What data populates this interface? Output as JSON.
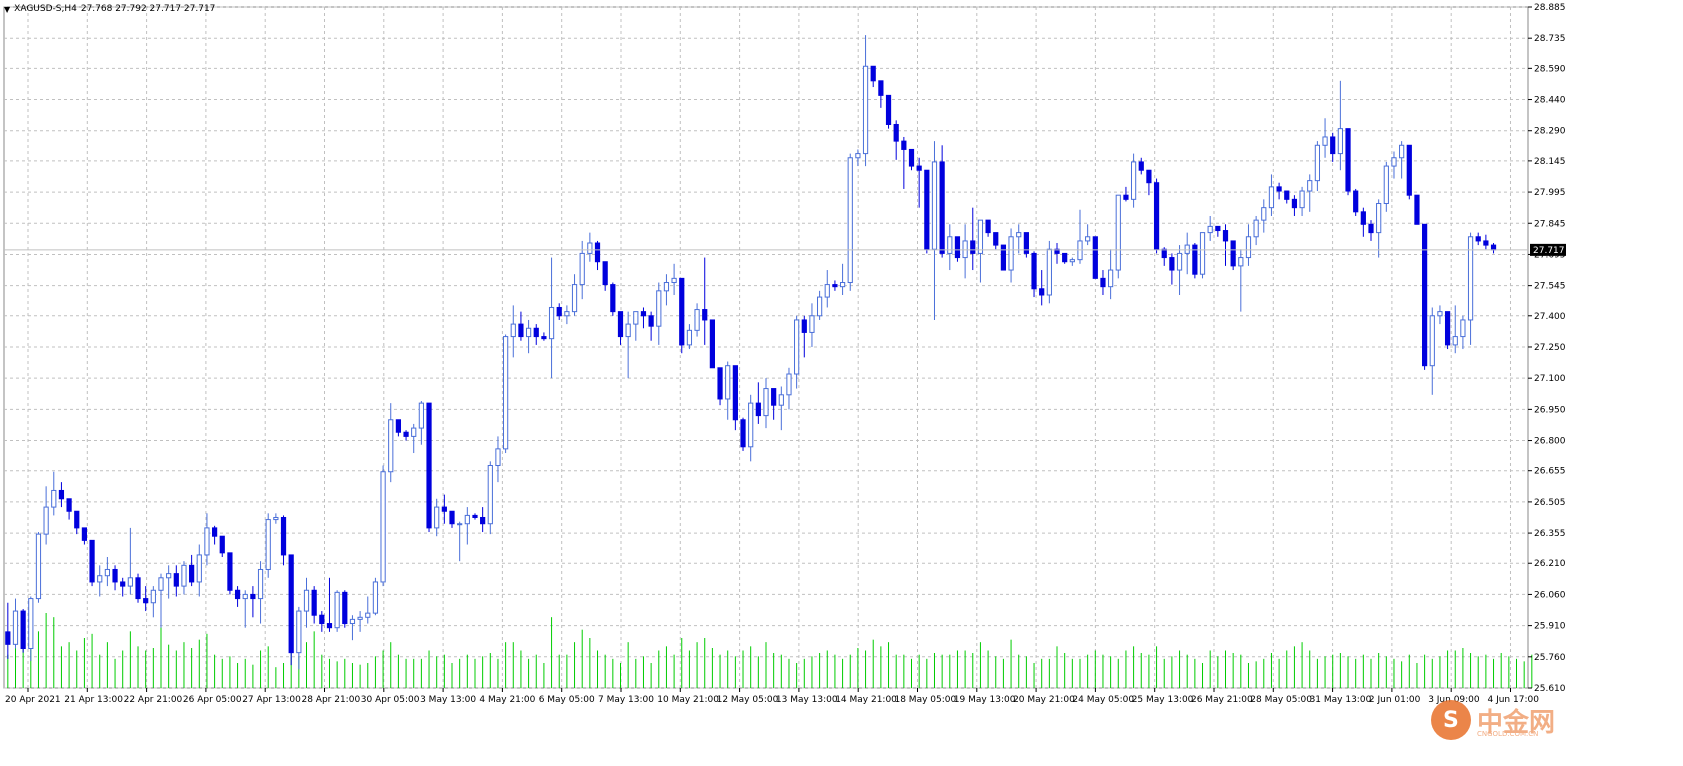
{
  "header": {
    "symbol": "XAGUSD-S,H4",
    "ohlc": "27.768 27.792 27.717 27.717"
  },
  "watermark": {
    "glyph": "S",
    "name": "中金网",
    "site": "CNGOLD.COM.CN"
  },
  "colors": {
    "bear": "#0000dd",
    "bull": "#4a6fd9",
    "volume": "#00cc00",
    "grid": "#c0c0c0",
    "last_price_line": "#c0c0c0",
    "price_label_bg": "#000000"
  },
  "chart_data": {
    "type": "candlestick",
    "y_ticks": [
      "28.885",
      "28.735",
      "28.590",
      "28.440",
      "28.290",
      "28.145",
      "27.995",
      "27.845",
      "27.695",
      "27.545",
      "27.400",
      "27.250",
      "27.100",
      "26.950",
      "26.800",
      "26.655",
      "26.505",
      "26.355",
      "26.210",
      "26.060",
      "25.910",
      "25.760",
      "25.610"
    ],
    "ylim": [
      25.61,
      28.885
    ],
    "x_ticks": [
      "20 Apr 2021",
      "21 Apr 13:00",
      "22 Apr 21:00",
      "26 Apr 05:00",
      "27 Apr 13:00",
      "28 Apr 21:00",
      "30 Apr 05:00",
      "3 May 13:00",
      "4 May 21:00",
      "6 May 05:00",
      "7 May 13:00",
      "10 May 21:00",
      "12 May 05:00",
      "13 May 13:00",
      "14 May 21:00",
      "18 May 05:00",
      "19 May 13:00",
      "20 May 21:00",
      "24 May 05:00",
      "25 May 13:00",
      "26 May 21:00",
      "28 May 05:00",
      "31 May 13:00",
      "2 Jun 01:00",
      "3 Jun 09:00",
      "4 Jun 17:00"
    ],
    "last_price": "27.717",
    "ohlc": [
      [
        25.88,
        26.02,
        25.75,
        25.82
      ],
      [
        25.82,
        26.04,
        25.8,
        25.98
      ],
      [
        25.98,
        25.99,
        25.78,
        25.8
      ],
      [
        25.8,
        26.05,
        25.74,
        26.04
      ],
      [
        26.04,
        26.36,
        26.02,
        26.35
      ],
      [
        26.35,
        26.58,
        26.3,
        26.48
      ],
      [
        26.48,
        26.65,
        26.44,
        26.56
      ],
      [
        26.56,
        26.6,
        26.48,
        26.52
      ],
      [
        26.52,
        26.49,
        26.42,
        26.46
      ],
      [
        26.46,
        26.45,
        26.35,
        26.38
      ],
      [
        26.38,
        26.34,
        26.3,
        26.32
      ],
      [
        26.32,
        26.3,
        26.1,
        26.12
      ],
      [
        26.12,
        26.2,
        26.05,
        26.15
      ],
      [
        26.15,
        26.24,
        26.1,
        26.18
      ],
      [
        26.18,
        26.2,
        26.08,
        26.12
      ],
      [
        26.12,
        26.14,
        26.05,
        26.1
      ],
      [
        26.1,
        26.38,
        26.06,
        26.14
      ],
      [
        26.14,
        26.16,
        26.02,
        26.04
      ],
      [
        26.04,
        26.1,
        25.98,
        26.02
      ],
      [
        26.02,
        26.1,
        25.95,
        26.08
      ],
      [
        26.08,
        26.16,
        25.9,
        26.14
      ],
      [
        26.14,
        26.2,
        26.04,
        26.16
      ],
      [
        26.16,
        26.2,
        26.05,
        26.1
      ],
      [
        26.1,
        26.22,
        26.06,
        26.2
      ],
      [
        26.2,
        26.25,
        26.1,
        26.12
      ],
      [
        26.12,
        26.3,
        26.05,
        26.25
      ],
      [
        26.25,
        26.45,
        26.2,
        26.38
      ],
      [
        26.38,
        26.39,
        26.3,
        26.34
      ],
      [
        26.34,
        26.33,
        26.24,
        26.26
      ],
      [
        26.26,
        26.25,
        26.06,
        26.08
      ],
      [
        26.08,
        26.1,
        26.0,
        26.04
      ],
      [
        26.04,
        26.08,
        25.9,
        26.06
      ],
      [
        26.06,
        26.1,
        25.95,
        26.04
      ],
      [
        26.04,
        26.22,
        25.92,
        26.18
      ],
      [
        26.18,
        26.45,
        26.14,
        26.42
      ],
      [
        26.42,
        26.45,
        26.4,
        26.43
      ],
      [
        26.43,
        26.44,
        26.2,
        26.25
      ],
      [
        26.25,
        26.23,
        25.72,
        25.78
      ],
      [
        25.78,
        26.0,
        25.7,
        25.98
      ],
      [
        25.98,
        26.14,
        25.9,
        26.08
      ],
      [
        26.08,
        26.1,
        25.92,
        25.96
      ],
      [
        25.96,
        25.98,
        25.88,
        25.92
      ],
      [
        25.92,
        26.14,
        25.88,
        25.9
      ],
      [
        25.9,
        26.08,
        25.88,
        26.07
      ],
      [
        26.07,
        26.08,
        25.9,
        25.92
      ],
      [
        25.92,
        25.96,
        25.84,
        25.94
      ],
      [
        25.94,
        25.98,
        25.88,
        25.95
      ],
      [
        25.95,
        26.05,
        25.92,
        25.97
      ],
      [
        25.97,
        26.14,
        25.96,
        26.12
      ],
      [
        26.12,
        26.68,
        26.1,
        26.65
      ],
      [
        26.65,
        26.98,
        26.6,
        26.9
      ],
      [
        26.9,
        26.88,
        26.82,
        26.84
      ],
      [
        26.84,
        26.85,
        26.8,
        26.82
      ],
      [
        26.82,
        26.88,
        26.74,
        26.86
      ],
      [
        26.86,
        26.99,
        26.78,
        26.98
      ],
      [
        26.98,
        26.97,
        26.36,
        26.38
      ],
      [
        26.38,
        26.52,
        26.34,
        26.48
      ],
      [
        26.48,
        26.54,
        26.4,
        26.46
      ],
      [
        26.46,
        26.45,
        26.38,
        26.4
      ],
      [
        26.4,
        26.41,
        26.22,
        26.4
      ],
      [
        26.4,
        26.48,
        26.3,
        26.44
      ],
      [
        26.44,
        26.45,
        26.42,
        26.43
      ],
      [
        26.43,
        26.48,
        26.36,
        26.4
      ],
      [
        26.4,
        26.7,
        26.35,
        26.68
      ],
      [
        26.68,
        26.82,
        26.6,
        26.76
      ],
      [
        26.76,
        27.31,
        26.74,
        27.3
      ],
      [
        27.3,
        27.45,
        27.2,
        27.36
      ],
      [
        27.36,
        27.42,
        27.28,
        27.3
      ],
      [
        27.3,
        27.38,
        27.22,
        27.34
      ],
      [
        27.34,
        27.36,
        27.26,
        27.3
      ],
      [
        27.3,
        27.32,
        27.28,
        27.29
      ],
      [
        27.29,
        27.68,
        27.1,
        27.44
      ],
      [
        27.44,
        27.46,
        27.38,
        27.4
      ],
      [
        27.4,
        27.45,
        27.36,
        27.42
      ],
      [
        27.42,
        27.6,
        27.4,
        27.55
      ],
      [
        27.55,
        27.76,
        27.48,
        27.7
      ],
      [
        27.7,
        27.8,
        27.66,
        27.75
      ],
      [
        27.75,
        27.76,
        27.62,
        27.66
      ],
      [
        27.66,
        27.64,
        27.52,
        27.55
      ],
      [
        27.55,
        27.56,
        27.4,
        27.42
      ],
      [
        27.42,
        27.4,
        27.26,
        27.3
      ],
      [
        27.3,
        27.42,
        27.1,
        27.36
      ],
      [
        27.36,
        27.4,
        27.28,
        27.42
      ],
      [
        27.42,
        27.44,
        27.34,
        27.4
      ],
      [
        27.4,
        27.42,
        27.28,
        27.35
      ],
      [
        27.35,
        27.56,
        27.26,
        27.52
      ],
      [
        27.52,
        27.6,
        27.45,
        27.56
      ],
      [
        27.56,
        27.65,
        27.5,
        27.58
      ],
      [
        27.58,
        27.57,
        27.22,
        27.26
      ],
      [
        27.26,
        27.36,
        27.24,
        27.33
      ],
      [
        27.33,
        27.46,
        27.3,
        27.43
      ],
      [
        27.43,
        27.68,
        27.26,
        27.38
      ],
      [
        27.38,
        27.36,
        27.18,
        27.15
      ],
      [
        27.15,
        27.14,
        26.97,
        27.0
      ],
      [
        27.0,
        27.18,
        26.9,
        27.16
      ],
      [
        27.16,
        27.15,
        26.85,
        26.9
      ],
      [
        26.9,
        26.91,
        26.75,
        26.77
      ],
      [
        26.77,
        27.02,
        26.7,
        26.98
      ],
      [
        26.98,
        27.08,
        26.88,
        26.92
      ],
      [
        26.92,
        27.1,
        26.86,
        27.05
      ],
      [
        27.05,
        27.04,
        26.9,
        26.97
      ],
      [
        26.97,
        27.06,
        26.85,
        27.02
      ],
      [
        27.02,
        27.15,
        26.95,
        27.12
      ],
      [
        27.12,
        27.4,
        27.05,
        27.38
      ],
      [
        27.38,
        27.4,
        27.2,
        27.32
      ],
      [
        27.32,
        27.46,
        27.25,
        27.4
      ],
      [
        27.4,
        27.52,
        27.38,
        27.49
      ],
      [
        27.49,
        27.62,
        27.44,
        27.55
      ],
      [
        27.55,
        27.57,
        27.52,
        27.54
      ],
      [
        27.54,
        27.65,
        27.5,
        27.56
      ],
      [
        27.56,
        28.18,
        27.52,
        28.16
      ],
      [
        28.16,
        28.2,
        28.12,
        28.18
      ],
      [
        28.18,
        28.75,
        28.12,
        28.6
      ],
      [
        28.6,
        28.59,
        28.5,
        28.53
      ],
      [
        28.53,
        28.5,
        28.4,
        28.46
      ],
      [
        28.46,
        28.45,
        28.3,
        28.32
      ],
      [
        28.32,
        28.34,
        28.15,
        28.24
      ],
      [
        28.24,
        28.26,
        28.01,
        28.2
      ],
      [
        28.2,
        28.19,
        28.1,
        28.12
      ],
      [
        28.12,
        28.16,
        27.92,
        28.1
      ],
      [
        28.1,
        28.1,
        27.7,
        27.72
      ],
      [
        27.72,
        28.24,
        27.38,
        28.14
      ],
      [
        28.14,
        28.22,
        27.68,
        27.7
      ],
      [
        27.7,
        27.84,
        27.62,
        27.78
      ],
      [
        27.78,
        27.76,
        27.66,
        27.68
      ],
      [
        27.68,
        27.84,
        27.58,
        27.76
      ],
      [
        27.76,
        27.92,
        27.62,
        27.7
      ],
      [
        27.7,
        27.85,
        27.56,
        27.86
      ],
      [
        27.86,
        27.85,
        27.78,
        27.8
      ],
      [
        27.8,
        27.79,
        27.72,
        27.74
      ],
      [
        27.74,
        27.73,
        27.62,
        27.62
      ],
      [
        27.62,
        27.82,
        27.56,
        27.78
      ],
      [
        27.78,
        27.84,
        27.7,
        27.8
      ],
      [
        27.8,
        27.79,
        27.68,
        27.7
      ],
      [
        27.7,
        27.71,
        27.49,
        27.53
      ],
      [
        27.53,
        27.62,
        27.45,
        27.5
      ],
      [
        27.5,
        27.76,
        27.46,
        27.72
      ],
      [
        27.72,
        27.75,
        27.65,
        27.7
      ],
      [
        27.7,
        27.68,
        27.65,
        27.66
      ],
      [
        27.66,
        27.68,
        27.64,
        27.67
      ],
      [
        27.67,
        27.91,
        27.65,
        27.76
      ],
      [
        27.76,
        27.84,
        27.74,
        27.78
      ],
      [
        27.78,
        27.76,
        27.62,
        27.58
      ],
      [
        27.58,
        27.62,
        27.5,
        27.54
      ],
      [
        27.54,
        27.72,
        27.48,
        27.62
      ],
      [
        27.62,
        27.83,
        27.58,
        27.98
      ],
      [
        27.98,
        28.02,
        27.95,
        27.96
      ],
      [
        27.96,
        28.18,
        27.92,
        28.14
      ],
      [
        28.14,
        28.16,
        28.08,
        28.1
      ],
      [
        28.1,
        28.09,
        27.98,
        28.04
      ],
      [
        28.04,
        28.06,
        27.7,
        27.72
      ],
      [
        27.72,
        27.73,
        27.64,
        27.68
      ],
      [
        27.68,
        27.7,
        27.55,
        27.62
      ],
      [
        27.62,
        27.74,
        27.5,
        27.7
      ],
      [
        27.7,
        27.8,
        27.6,
        27.74
      ],
      [
        27.74,
        27.75,
        27.58,
        27.6
      ],
      [
        27.6,
        27.76,
        27.58,
        27.8
      ],
      [
        27.8,
        27.88,
        27.76,
        27.83
      ],
      [
        27.83,
        27.82,
        27.78,
        27.81
      ],
      [
        27.81,
        27.84,
        27.64,
        27.76
      ],
      [
        27.76,
        27.74,
        27.62,
        27.64
      ],
      [
        27.64,
        27.72,
        27.42,
        27.68
      ],
      [
        27.68,
        27.84,
        27.64,
        27.78
      ],
      [
        27.78,
        27.88,
        27.74,
        27.86
      ],
      [
        27.86,
        27.96,
        27.8,
        27.92
      ],
      [
        27.92,
        28.08,
        27.88,
        28.02
      ],
      [
        28.02,
        28.04,
        27.96,
        28.0
      ],
      [
        28.0,
        28.0,
        27.94,
        27.96
      ],
      [
        27.96,
        27.98,
        27.88,
        27.92
      ],
      [
        27.92,
        28.02,
        27.88,
        28.0
      ],
      [
        28.0,
        28.08,
        27.9,
        28.05
      ],
      [
        28.05,
        28.24,
        28.0,
        28.22
      ],
      [
        28.22,
        28.35,
        28.16,
        28.26
      ],
      [
        28.26,
        28.28,
        28.14,
        28.18
      ],
      [
        28.18,
        28.53,
        28.1,
        28.3
      ],
      [
        28.3,
        28.29,
        27.98,
        28.0
      ],
      [
        28.0,
        28.01,
        27.88,
        27.9
      ],
      [
        27.9,
        27.92,
        27.78,
        27.84
      ],
      [
        27.84,
        27.86,
        27.76,
        27.8
      ],
      [
        27.8,
        27.96,
        27.68,
        27.94
      ],
      [
        27.94,
        28.14,
        27.9,
        28.12
      ],
      [
        28.12,
        28.19,
        28.06,
        28.16
      ],
      [
        28.16,
        28.24,
        28.06,
        28.22
      ],
      [
        28.22,
        28.21,
        27.96,
        27.98
      ],
      [
        27.98,
        27.97,
        27.84,
        27.84
      ],
      [
        27.84,
        27.83,
        27.14,
        27.16
      ],
      [
        27.16,
        27.44,
        27.02,
        27.4
      ],
      [
        27.4,
        27.45,
        27.36,
        27.42
      ],
      [
        27.42,
        27.4,
        27.24,
        27.26
      ],
      [
        27.26,
        27.45,
        27.22,
        27.3
      ],
      [
        27.3,
        27.4,
        27.24,
        27.38
      ],
      [
        27.38,
        27.8,
        27.26,
        27.78
      ],
      [
        27.78,
        27.8,
        27.74,
        27.76
      ],
      [
        27.76,
        27.79,
        27.72,
        27.74
      ],
      [
        27.74,
        27.75,
        27.7,
        27.717
      ]
    ],
    "volume": [
      40,
      75,
      70,
      65,
      68,
      90,
      85,
      50,
      55,
      45,
      60,
      65,
      40,
      55,
      35,
      45,
      68,
      50,
      45,
      48,
      80,
      52,
      45,
      55,
      48,
      58,
      65,
      40,
      35,
      38,
      30,
      35,
      28,
      45,
      50,
      25,
      30,
      45,
      38,
      55,
      68,
      40,
      35,
      32,
      35,
      30,
      28,
      30,
      38,
      45,
      55,
      40,
      35,
      35,
      35,
      45,
      38,
      40,
      30,
      35,
      40,
      35,
      38,
      42,
      35,
      55,
      55,
      45,
      35,
      40,
      30,
      85,
      40,
      40,
      55,
      70,
      60,
      45,
      40,
      35,
      30,
      55,
      35,
      38,
      30,
      45,
      50,
      40,
      60,
      45,
      55,
      60,
      48,
      40,
      45,
      38,
      45,
      50,
      38,
      55,
      42,
      40,
      35,
      30,
      35,
      38,
      42,
      45,
      40,
      35,
      40,
      48,
      45,
      58,
      50,
      55,
      40,
      40,
      35,
      40,
      35,
      42,
      40,
      40,
      45,
      45,
      42,
      55,
      45,
      38,
      35,
      58,
      40,
      38,
      30,
      35,
      35,
      50,
      42,
      35,
      35,
      40,
      45,
      40,
      38,
      35,
      45,
      50,
      42,
      40,
      50,
      35,
      38,
      45,
      40,
      35,
      30,
      45,
      38,
      45,
      42,
      40,
      30,
      32,
      35,
      42,
      35,
      45,
      50,
      55,
      45,
      35,
      38,
      40,
      42,
      38,
      35,
      40,
      35,
      42,
      38,
      35,
      32,
      40,
      30,
      40,
      35,
      38,
      45,
      45,
      48,
      42,
      38,
      40,
      35,
      42,
      38,
      35,
      32,
      40
    ]
  }
}
